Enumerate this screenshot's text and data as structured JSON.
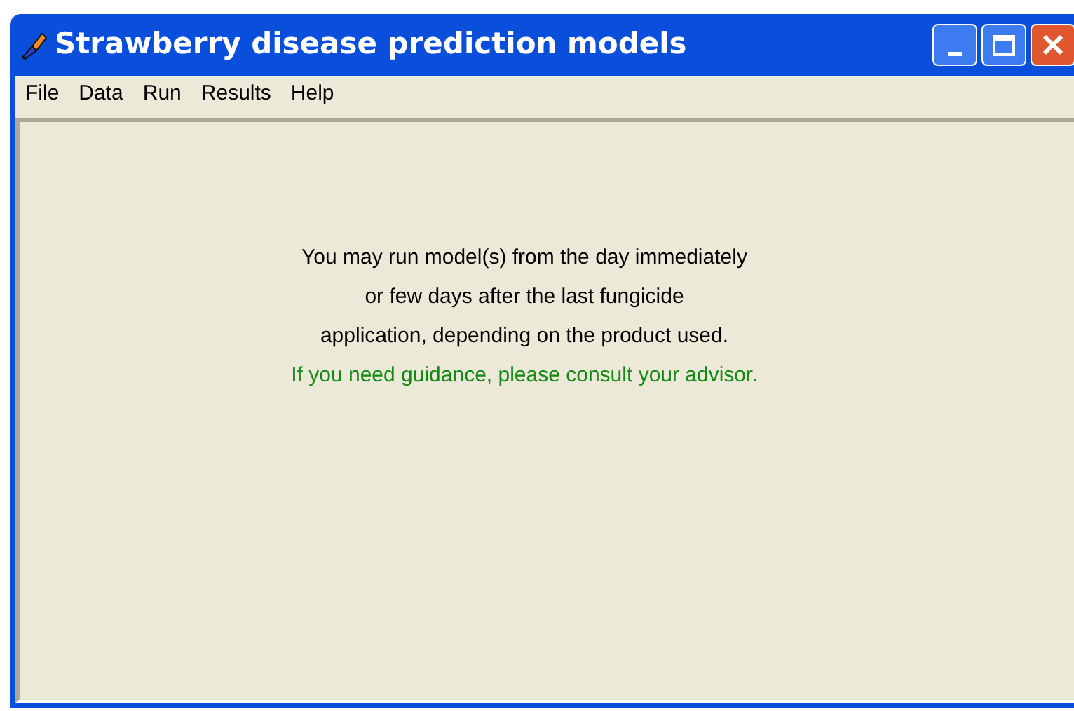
{
  "window": {
    "title": "Strawberry disease prediction models"
  },
  "menu": [
    "File",
    "Data",
    "Run",
    "Results",
    "Help"
  ],
  "message": [
    {
      "kind": "info",
      "text": "You may run model(s) from the day immediately"
    },
    {
      "kind": "info",
      "text": "or few days after the last fungicide"
    },
    {
      "kind": "info",
      "text": "application, depending on the product used."
    },
    {
      "kind": "advice",
      "text": "If you need guidance, please consult your advisor."
    }
  ]
}
